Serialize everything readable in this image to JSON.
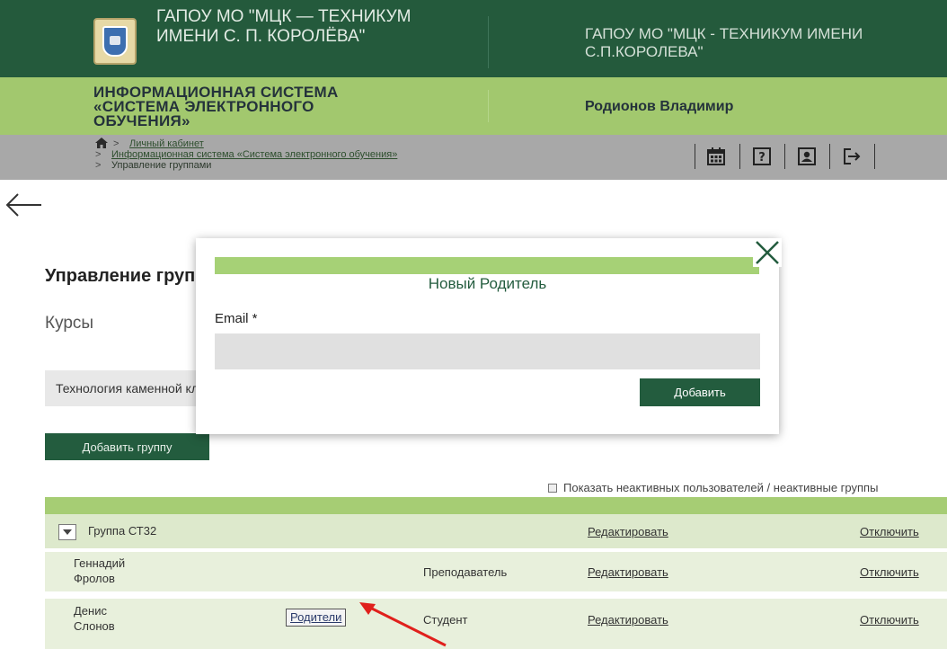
{
  "header": {
    "org_title": "ГАПОУ МО \"МЦК — ТЕХНИКУМ ИМЕНИ С. П. КОРОЛЁВА\"",
    "org_short": "ГАПОУ МО \"МЦК - ТЕХНИКУМ ИМЕНИ С.П.КОРОЛЕВА\"",
    "system_title": "ИНФОРМАЦИОННАЯ СИСТЕМА «СИСТЕМА ЭЛЕКТРОННОГО ОБУЧЕНИЯ»",
    "user_name": "Родионов Владимир"
  },
  "breadcrumbs": [
    {
      "label": "Личный кабинет",
      "link": true
    },
    {
      "label": "Информационная система «Система электронного обучения»",
      "link": true
    },
    {
      "label": "Управление группами",
      "link": false
    }
  ],
  "toolbar": {
    "icons": [
      "calendar-icon",
      "help-icon",
      "profile-icon",
      "logout-icon"
    ]
  },
  "page": {
    "title": "Управление группами",
    "courses_label": "Курсы",
    "course_value": "Технология каменной кладки",
    "add_group_label": "Добавить группу",
    "show_inactive_label": "Показать неактивных пользователей / неактивные группы"
  },
  "groups": [
    {
      "name": "Группа СТ32",
      "edit_label": "Редактировать",
      "disable_label": "Отключить",
      "members": [
        {
          "first": "Геннадий",
          "last": "Фролов",
          "role": "Преподаватель",
          "edit_label": "Редактировать",
          "disable_label": "Отключить",
          "parents_label": ""
        },
        {
          "first": "Денис",
          "last": "Слонов",
          "role": "Студент",
          "edit_label": "Редактировать",
          "disable_label": "Отключить",
          "parents_label": "Родители"
        }
      ]
    }
  ],
  "modal": {
    "title": "Новый Родитель",
    "email_label": "Email *",
    "email_value": "",
    "submit_label": "Добавить"
  },
  "colors": {
    "header_dark": "#245a3c",
    "header_green": "#a2c86e",
    "breadcrumb_bar": "#a8a8a8",
    "button_green": "#235c3e",
    "modal_bar": "#a6d176",
    "annotation_arrow": "#e0201c"
  }
}
